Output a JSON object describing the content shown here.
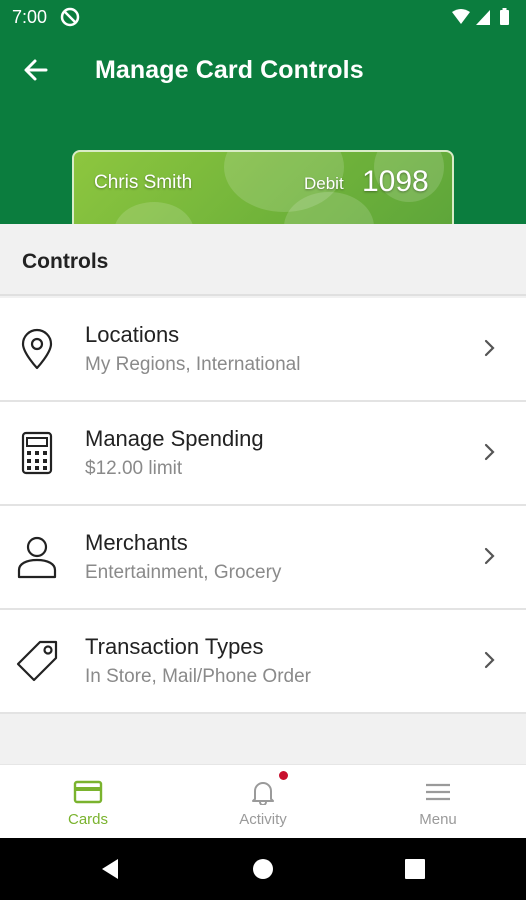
{
  "status": {
    "time": "7:00"
  },
  "header": {
    "title": "Manage Card Controls"
  },
  "card": {
    "holder": "Chris Smith",
    "type": "Debit",
    "last4": "1098"
  },
  "section": {
    "title": "Controls"
  },
  "controls": [
    {
      "label": "Locations",
      "sub": "My Regions, International",
      "icon": "location-pin-icon"
    },
    {
      "label": "Manage Spending",
      "sub": "$12.00 limit",
      "icon": "calculator-icon"
    },
    {
      "label": "Merchants",
      "sub": "Entertainment, Grocery",
      "icon": "person-icon"
    },
    {
      "label": "Transaction Types",
      "sub": "In Store, Mail/Phone Order",
      "icon": "tag-icon"
    }
  ],
  "tabs": [
    {
      "label": "Cards",
      "icon": "card-icon",
      "active": true
    },
    {
      "label": "Activity",
      "icon": "bell-icon",
      "active": false
    },
    {
      "label": "Menu",
      "icon": "hamburger-icon",
      "active": false
    }
  ],
  "colors": {
    "brand": "#0b7d3e",
    "accent": "#7ab32e",
    "badge": "#c8102e"
  }
}
